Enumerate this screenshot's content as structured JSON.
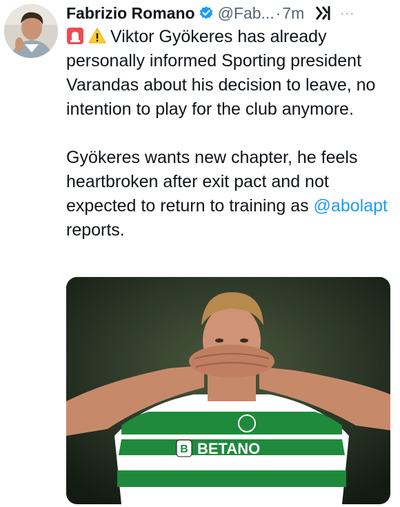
{
  "tweet": {
    "author_name": "Fabrizio Romano",
    "handle": "@Fab...",
    "separator": "·",
    "time": "7m",
    "more": "···",
    "paragraph1": "Viktor Gyökeres has already personally informed Sporting president Varandas about his decision to leave, no intention to play for the club anymore.",
    "paragraph2_before": "Gyökeres wants new chapter, he feels heartbroken after exit pact and not expected to return to training as ",
    "mention": "@abolapt",
    "paragraph2_after": " reports.",
    "emojis": [
      "siren-icon",
      "warning-icon"
    ]
  },
  "media": {
    "sponsor_text": "BETANO",
    "sponsor_letter": "B"
  },
  "colors": {
    "link": "#1d9bf0",
    "secondary_text": "#536471",
    "verified": "#1d9bf0",
    "jersey_green": "#1f8a3c"
  }
}
